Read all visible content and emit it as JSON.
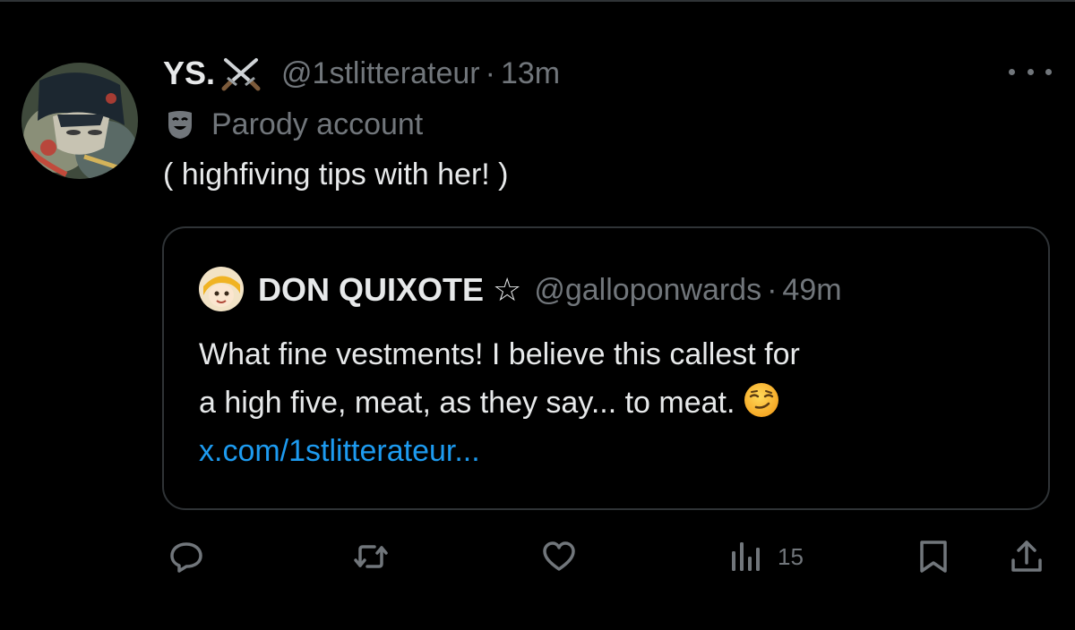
{
  "tweet": {
    "display_name": "YS.",
    "name_icon": "crossed-swords-icon",
    "handle": "@1stlitterateur",
    "separator": "·",
    "time": "13m",
    "parody_label": "Parody account",
    "text": "( highfiving tips with her! )"
  },
  "quote": {
    "display_name": "DON QUIXOTE",
    "badge": "☆",
    "handle": "@galloponwards",
    "separator": "·",
    "time": "49m",
    "text_line1": "What fine vestments! I believe this callest for",
    "text_line2": "a high five, meat, as they say... to meat.",
    "emoji": "smirking-face",
    "link": "x.com/1stlitterateur..."
  },
  "actions": {
    "reply_icon": "reply-icon",
    "repost_icon": "repost-icon",
    "like_icon": "heart-icon",
    "views_icon": "views-icon",
    "views_count": "15",
    "bookmark_icon": "bookmark-icon",
    "share_icon": "share-icon"
  },
  "colors": {
    "background": "#000000",
    "primary_text": "#e7e9ea",
    "secondary_text": "#71767b",
    "link": "#1d9bf0",
    "border": "#2f3336"
  }
}
